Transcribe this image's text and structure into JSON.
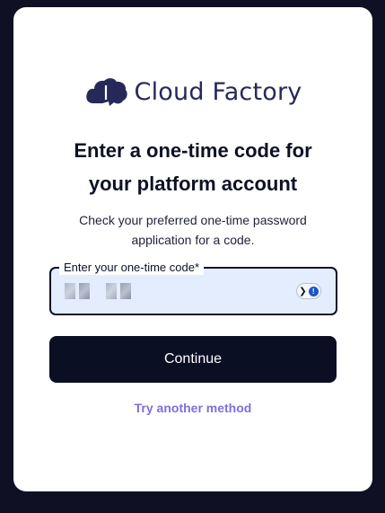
{
  "brand": {
    "name": "Cloud Factory",
    "logo_icon": "cloud-factory-logo-icon",
    "color": "#27285a"
  },
  "heading": {
    "line1": "Enter a one-time code for",
    "line2": "your platform account"
  },
  "subtitle": {
    "line1": "Check your preferred one-time password",
    "line2": "application for a code."
  },
  "code_field": {
    "label": "Enter your one-time code*",
    "value_obscured": true,
    "password_manager_icon": "password-manager-icon",
    "background": "#e3edfd",
    "border": "#0c1028"
  },
  "actions": {
    "continue_label": "Continue",
    "alternate_label": "Try another method",
    "primary_color": "#0a0f24",
    "link_color": "#7d6fe0"
  },
  "colors": {
    "page_background": "#0f1024",
    "card_background": "#ffffff"
  }
}
